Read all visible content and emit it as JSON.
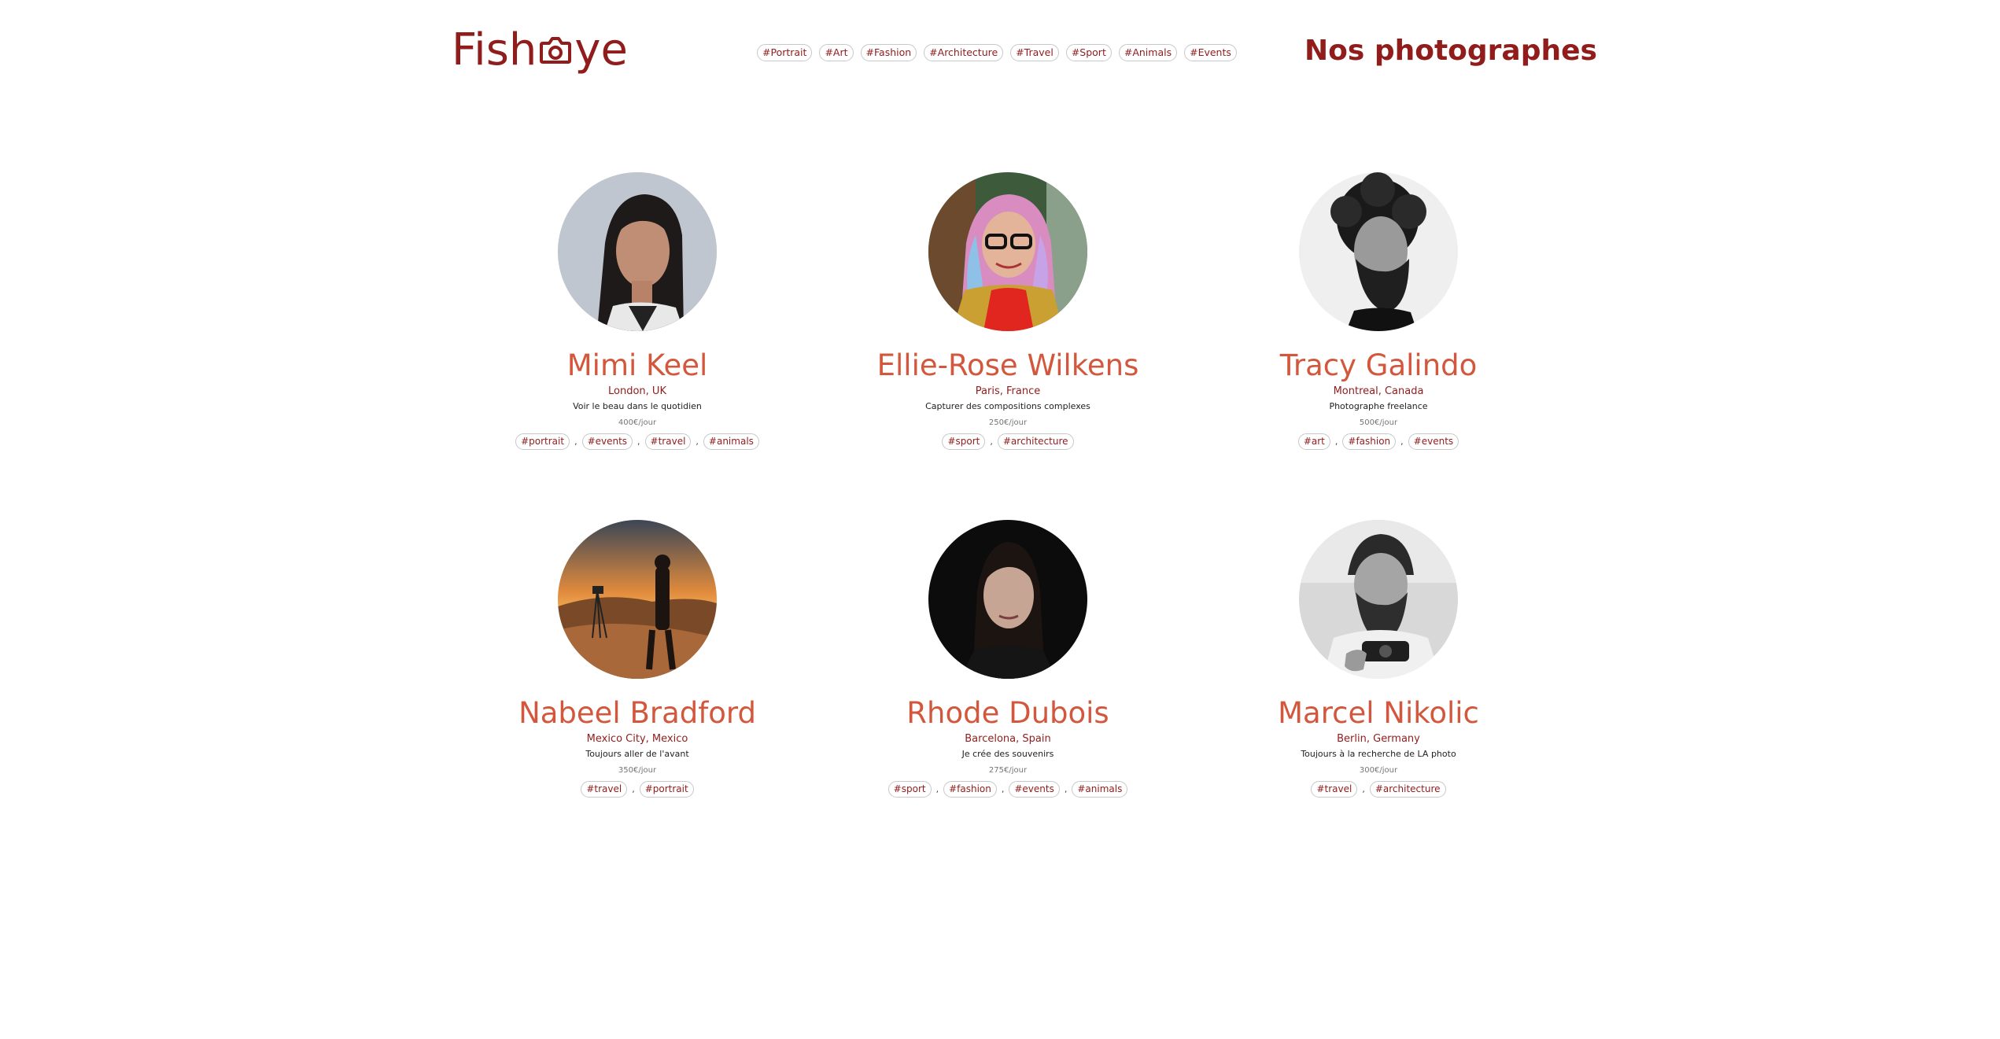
{
  "header": {
    "logo_text": "Fisheye",
    "title": "Nos photographes",
    "nav_tags": [
      "#Portrait",
      "#Art",
      "#Fashion",
      "#Architecture",
      "#Travel",
      "#Sport",
      "#Animals",
      "#Events"
    ]
  },
  "colors": {
    "brand": "#901c1c",
    "name": "#d3573c"
  },
  "photographers": [
    {
      "name": "Mimi Keel",
      "location": "London, UK",
      "tagline": "Voir le beau dans le quotidien",
      "price": "400€/jour",
      "tags": [
        "#portrait",
        "#events",
        "#travel",
        "#animals"
      ]
    },
    {
      "name": "Ellie-Rose Wilkens",
      "location": "Paris, France",
      "tagline": "Capturer des compositions complexes",
      "price": "250€/jour",
      "tags": [
        "#sport",
        "#architecture"
      ]
    },
    {
      "name": "Tracy Galindo",
      "location": "Montreal, Canada",
      "tagline": "Photographe freelance",
      "price": "500€/jour",
      "tags": [
        "#art",
        "#fashion",
        "#events"
      ]
    },
    {
      "name": "Nabeel Bradford",
      "location": "Mexico City, Mexico",
      "tagline": "Toujours aller de l'avant",
      "price": "350€/jour",
      "tags": [
        "#travel",
        "#portrait"
      ]
    },
    {
      "name": "Rhode Dubois",
      "location": "Barcelona, Spain",
      "tagline": "Je crée des souvenirs",
      "price": "275€/jour",
      "tags": [
        "#sport",
        "#fashion",
        "#events",
        "#animals"
      ]
    },
    {
      "name": "Marcel Nikolic",
      "location": "Berlin, Germany",
      "tagline": "Toujours à la recherche de LA photo",
      "price": "300€/jour",
      "tags": [
        "#travel",
        "#architecture"
      ]
    }
  ]
}
